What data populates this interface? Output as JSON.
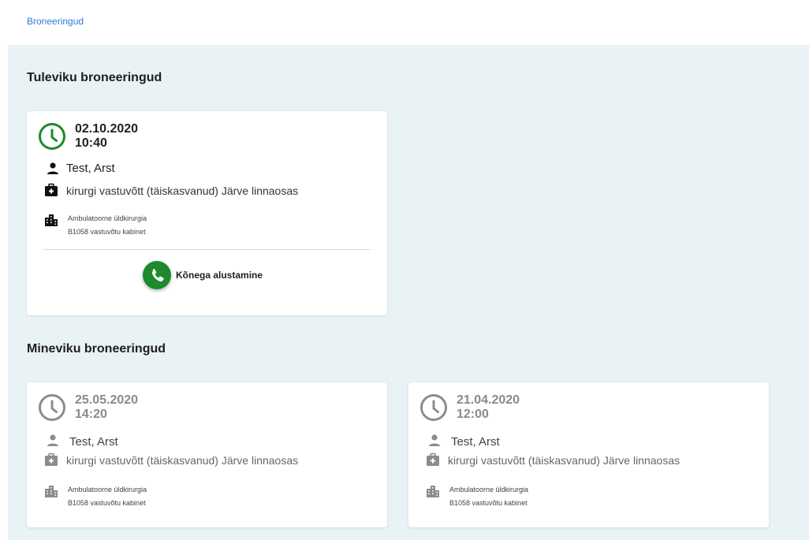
{
  "breadcrumb": "Broneeringud",
  "colors": {
    "accent": "#1d8a2b",
    "link": "#2f7bd0",
    "background": "#e9f2f5",
    "muted_icon": "#8c8c8c"
  },
  "future": {
    "title": "Tuleviku broneeringud",
    "booking": {
      "date": "02.10.2020",
      "time": "10:40",
      "doctor": "Test, Arst",
      "service": "kirurgi vastuvõtt (täiskasvanud) Järve linnaosas",
      "department": "Ambulatoorne üldkirurgia",
      "room": "B1058 vastuvõtu kabinet",
      "call_label": "Kõnega alustamine",
      "icons": [
        "clock-icon",
        "person-icon",
        "medical-bag-icon",
        "building-icon",
        "phone-icon"
      ]
    }
  },
  "past": {
    "title": "Mineviku broneeringud",
    "bookings": [
      {
        "date": "25.05.2020",
        "time": "14:20",
        "doctor": "Test, Arst",
        "service": "kirurgi vastuvõtt (täiskasvanud) Järve linnaosas",
        "department": "Ambulatoorne üldkirurgia",
        "room": "B1058 vastuvõtu kabinet"
      },
      {
        "date": "21.04.2020",
        "time": "12:00",
        "doctor": "Test, Arst",
        "service": "kirurgi vastuvõtt (täiskasvanud) Järve linnaosas",
        "department": "Ambulatoorne üldkirurgia",
        "room": "B1058 vastuvõtu kabinet"
      }
    ]
  }
}
